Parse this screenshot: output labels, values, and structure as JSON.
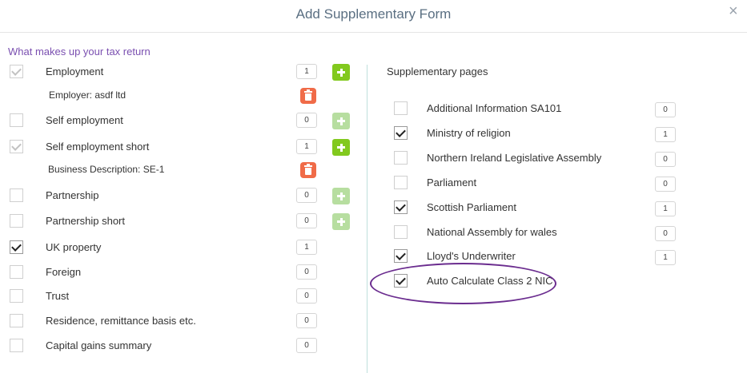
{
  "dialog": {
    "title": "Add Supplementary Form",
    "close_symbol": "×"
  },
  "left": {
    "section_title": "What makes up your tax return",
    "items": [
      {
        "label": "Employment",
        "checked": true,
        "disabled": true,
        "count": "1",
        "has_plus": true,
        "plus_enabled": true
      },
      {
        "label": "Self employment",
        "checked": false,
        "disabled": false,
        "count": "0",
        "has_plus": true,
        "plus_enabled": false
      },
      {
        "label": "Self employment short",
        "checked": true,
        "disabled": true,
        "count": "1",
        "has_plus": true,
        "plus_enabled": true
      },
      {
        "label": "Partnership",
        "checked": false,
        "disabled": false,
        "count": "0",
        "has_plus": true,
        "plus_enabled": false
      },
      {
        "label": "Partnership short",
        "checked": false,
        "disabled": false,
        "count": "0",
        "has_plus": true,
        "plus_enabled": false
      },
      {
        "label": "UK property",
        "checked": true,
        "disabled": false,
        "count": "1",
        "has_plus": false
      },
      {
        "label": "Foreign",
        "checked": false,
        "disabled": false,
        "count": "0",
        "has_plus": false
      },
      {
        "label": "Trust",
        "checked": false,
        "disabled": false,
        "count": "0",
        "has_plus": false
      },
      {
        "label": "Residence, remittance basis etc.",
        "checked": false,
        "disabled": false,
        "count": "0",
        "has_plus": false
      },
      {
        "label": "Capital gains summary",
        "checked": false,
        "disabled": false,
        "count": "0",
        "has_plus": false
      }
    ],
    "subitems": [
      {
        "text": "Employer: asdf ltd"
      },
      {
        "text": "Business Description: SE-1"
      }
    ]
  },
  "right": {
    "section_title": "Supplementary pages",
    "items": [
      {
        "label": "Additional Information SA101",
        "checked": false,
        "count": "0"
      },
      {
        "label": "Ministry of religion",
        "checked": true,
        "count": "1"
      },
      {
        "label": "Northern Ireland Legislative Assembly",
        "checked": false,
        "count": "0"
      },
      {
        "label": "Parliament",
        "checked": false,
        "count": "0"
      },
      {
        "label": "Scottish Parliament",
        "checked": true,
        "count": "1"
      },
      {
        "label": "National Assembly for wales",
        "checked": false,
        "count": "0"
      },
      {
        "label": "Lloyd's Underwriter",
        "checked": true,
        "count": "1"
      },
      {
        "label": "Auto Calculate Class 2 NIC",
        "checked": true,
        "count": null
      }
    ]
  },
  "colors": {
    "accent_purple": "#7a4fb0",
    "plus_green": "#82c91e",
    "delete_orange": "#f06b48",
    "highlight_ellipse": "#6b2d8f"
  }
}
